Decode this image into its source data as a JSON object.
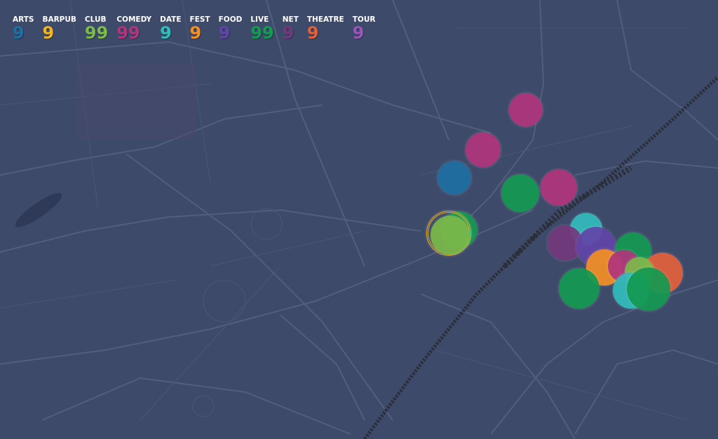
{
  "legend": [
    {
      "key": "arts",
      "label": "ARTS",
      "count": "9",
      "color": "#1f6fa3"
    },
    {
      "key": "barpub",
      "label": "BARPUB",
      "count": "9",
      "color": "#f2b51d"
    },
    {
      "key": "club",
      "label": "CLUB",
      "count": "99",
      "color": "#7cba4a"
    },
    {
      "key": "comedy",
      "label": "COMEDY",
      "count": "99",
      "color": "#b0357c"
    },
    {
      "key": "date",
      "label": "DATE",
      "count": "9",
      "color": "#33bcbc"
    },
    {
      "key": "fest",
      "label": "FEST",
      "count": "9",
      "color": "#f39025"
    },
    {
      "key": "food",
      "label": "FOOD",
      "count": "9",
      "color": "#6245a8"
    },
    {
      "key": "live",
      "label": "LIVE",
      "count": "99",
      "color": "#149a52"
    },
    {
      "key": "net",
      "label": "NET",
      "count": "9",
      "color": "#74387c"
    },
    {
      "key": "theatre",
      "label": "THEATRE",
      "count": "9",
      "color": "#e2613b"
    },
    {
      "key": "tour",
      "label": "TOUR",
      "count": "9",
      "color": "#9b55b8"
    }
  ]
}
